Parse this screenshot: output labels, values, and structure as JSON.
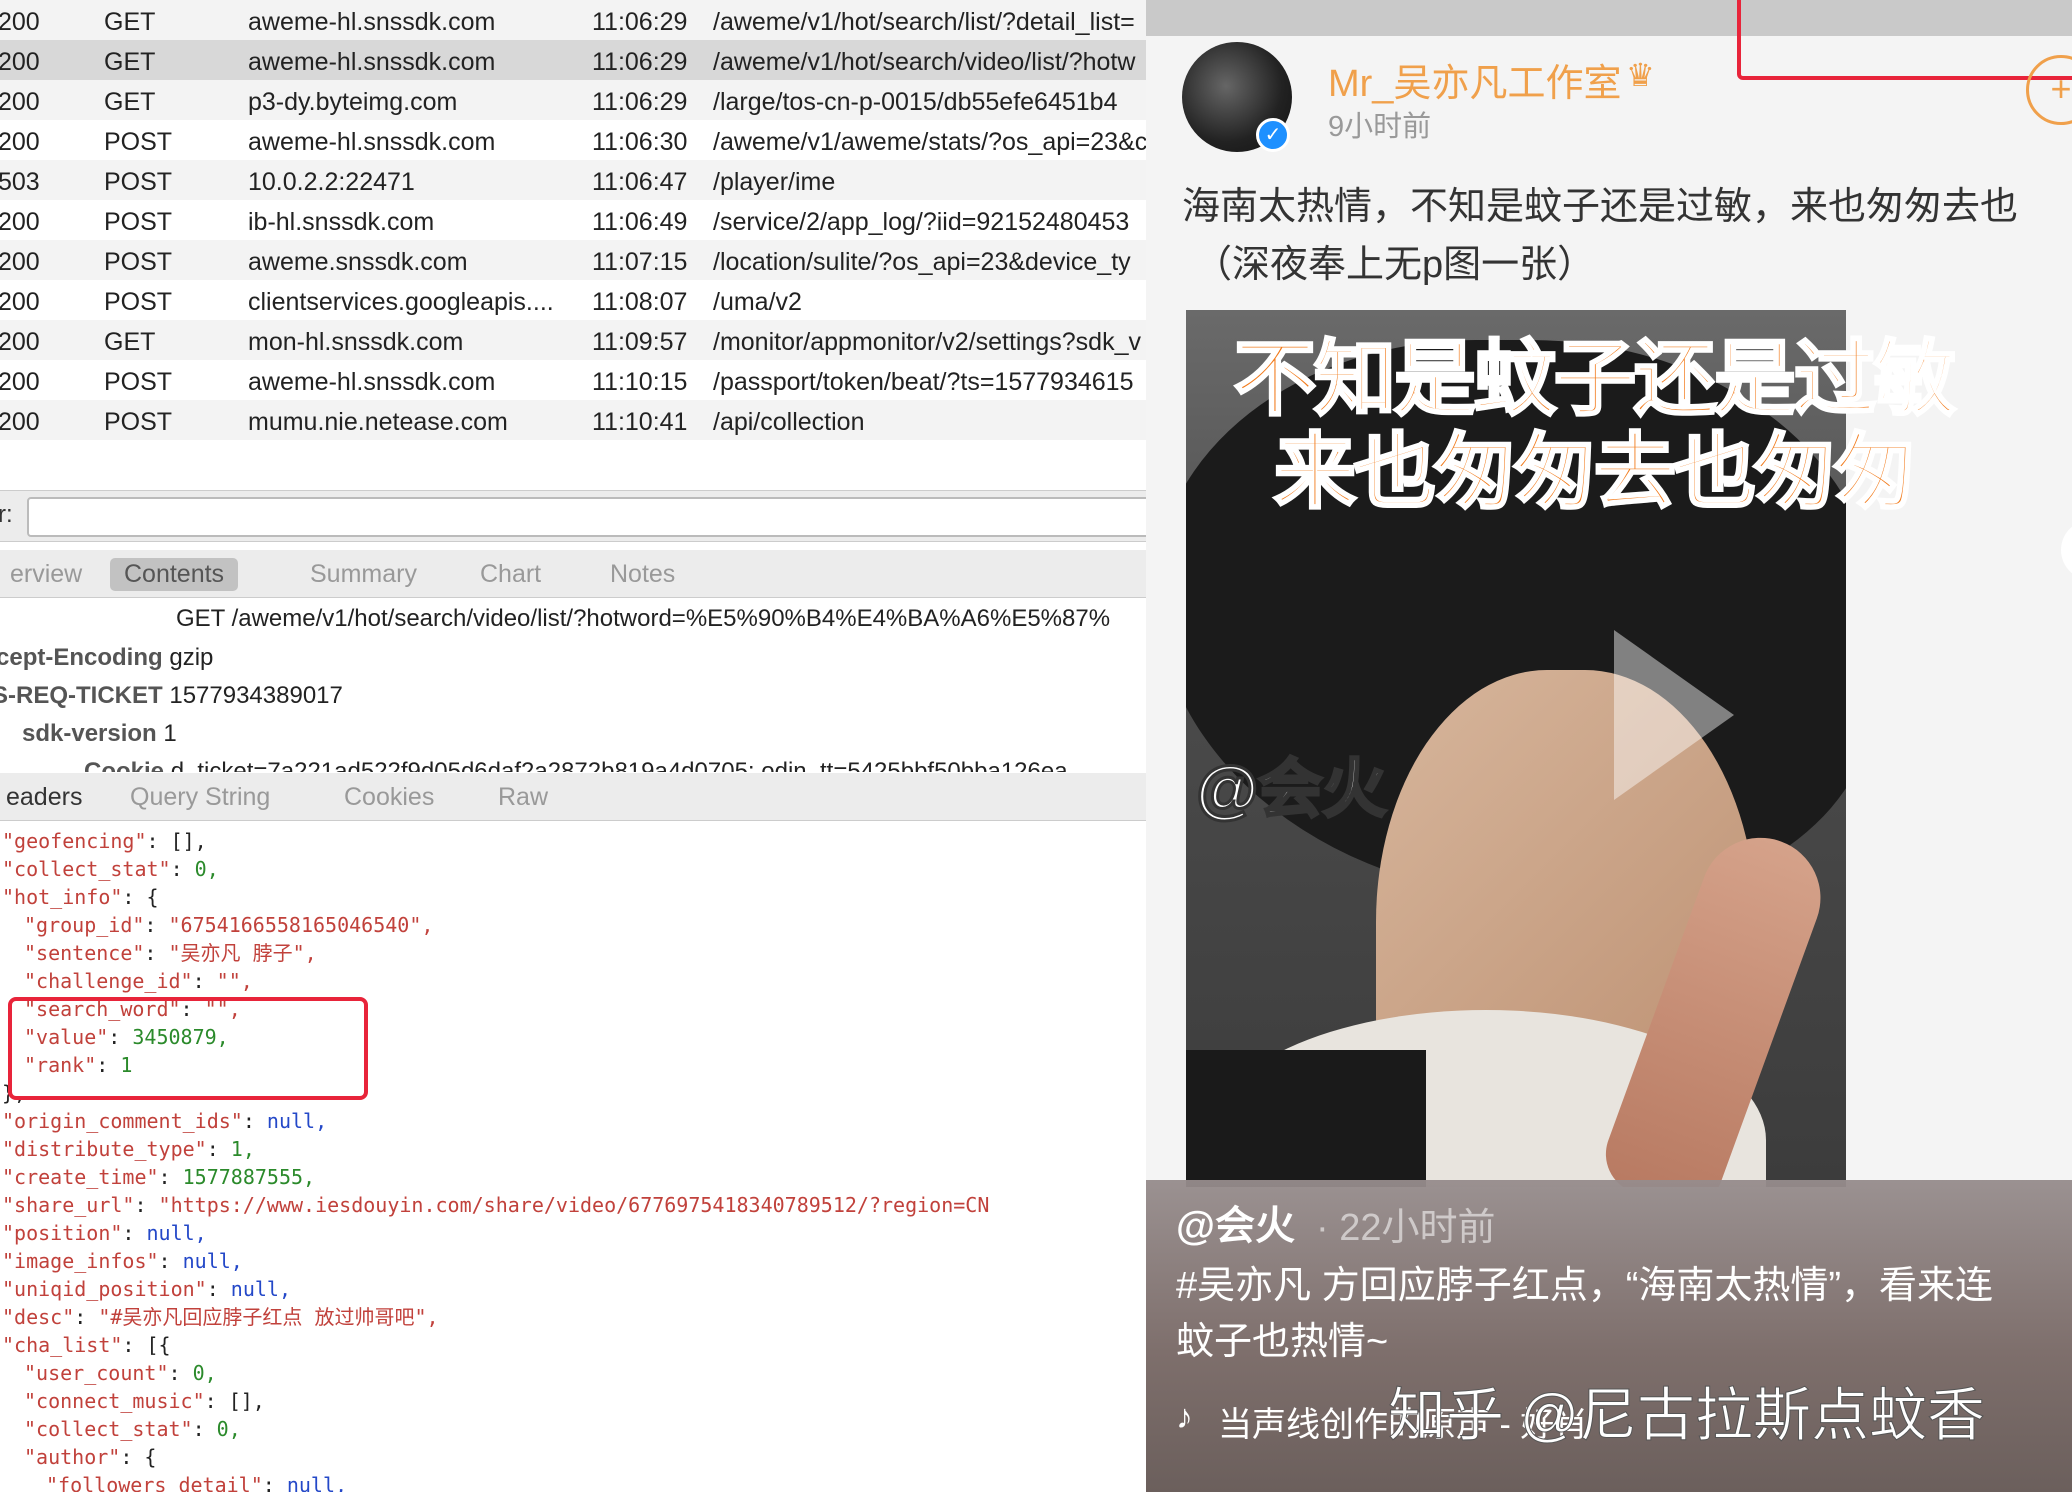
{
  "requests": [
    {
      "status": "200",
      "method": "GET",
      "host": "aweme-hl.snssdk.com",
      "time": "11:06:29",
      "path": "/aweme/v1/hot/search/list/?detail_list="
    },
    {
      "status": "200",
      "method": "GET",
      "host": "aweme-hl.snssdk.com",
      "time": "11:06:29",
      "path": "/aweme/v1/hot/search/video/list/?hotw"
    },
    {
      "status": "200",
      "method": "GET",
      "host": "p3-dy.byteimg.com",
      "time": "11:06:29",
      "path": "/large/tos-cn-p-0015/db55efe6451b4"
    },
    {
      "status": "200",
      "method": "POST",
      "host": "aweme-hl.snssdk.com",
      "time": "11:06:30",
      "path": "/aweme/v1/aweme/stats/?os_api=23&c"
    },
    {
      "status": "503",
      "method": "POST",
      "host": "10.0.2.2:22471",
      "time": "11:06:47",
      "path": "/player/ime"
    },
    {
      "status": "200",
      "method": "POST",
      "host": "ib-hl.snssdk.com",
      "time": "11:06:49",
      "path": "/service/2/app_log/?iid=92152480453"
    },
    {
      "status": "200",
      "method": "POST",
      "host": "aweme.snssdk.com",
      "time": "11:07:15",
      "path": "/location/sulite/?os_api=23&device_ty"
    },
    {
      "status": "200",
      "method": "POST",
      "host": "clientservices.googleapis....",
      "time": "11:08:07",
      "path": "/uma/v2"
    },
    {
      "status": "200",
      "method": "GET",
      "host": "mon-hl.snssdk.com",
      "time": "11:09:57",
      "path": "/monitor/appmonitor/v2/settings?sdk_v"
    },
    {
      "status": "200",
      "method": "POST",
      "host": "aweme-hl.snssdk.com",
      "time": "11:10:15",
      "path": "/passport/token/beat/?ts=1577934615"
    },
    {
      "status": "200",
      "method": "POST",
      "host": "mumu.nie.netease.com",
      "time": "11:10:41",
      "path": "/api/collection"
    }
  ],
  "filter": {
    "label": "r:",
    "value": ""
  },
  "top_tabs": [
    "erview",
    "Contents",
    "Summary",
    "Chart",
    "Notes"
  ],
  "request_line": "GET /aweme/v1/hot/search/video/list/?hotword=%E5%90%B4%E4%BA%A6%E5%87%",
  "headers": [
    {
      "key": "cept-Encoding",
      "value": "gzip"
    },
    {
      "key": "S-REQ-TICKET",
      "value": "1577934389017"
    },
    {
      "key": "sdk-version",
      "value": "1"
    },
    {
      "key": "Cookie",
      "value": "d_ticket=7a221ad522f9d05d6daf2a2872b819a4d0705; odin_tt=5425bbf50bba126ea"
    }
  ],
  "bottom_tabs": [
    "eaders",
    "Query String",
    "Cookies",
    "Raw"
  ],
  "json_lines": [
    {
      "k": "\"geofencing\"",
      "sep": ": ",
      "v": "[],",
      "vt": "p",
      "ind": 0
    },
    {
      "k": "\"collect_stat\"",
      "sep": ": ",
      "v": "0,",
      "vt": "n",
      "ind": 0
    },
    {
      "k": "\"hot_info\"",
      "sep": ": ",
      "v": "{",
      "vt": "p",
      "ind": 0
    },
    {
      "k": "\"group_id\"",
      "sep": ": ",
      "v": "\"6754166558165046540\",",
      "vt": "s",
      "ind": 1
    },
    {
      "k": "\"sentence\"",
      "sep": ": ",
      "v": "\"吴亦凡 脖子\",",
      "vt": "s",
      "ind": 1
    },
    {
      "k": "\"challenge_id\"",
      "sep": ": ",
      "v": "\"\",",
      "vt": "s",
      "ind": 1
    },
    {
      "k": "\"search_word\"",
      "sep": ": ",
      "v": "\"\",",
      "vt": "s",
      "ind": 1
    },
    {
      "k": "\"value\"",
      "sep": ": ",
      "v": "3450879,",
      "vt": "n",
      "ind": 1
    },
    {
      "k": "\"rank\"",
      "sep": ": ",
      "v": "1",
      "vt": "n",
      "ind": 1
    },
    {
      "k": "",
      "sep": "",
      "v": "},",
      "vt": "p",
      "ind": 0
    },
    {
      "k": "\"origin_comment_ids\"",
      "sep": ": ",
      "v": "null,",
      "vt": "l",
      "ind": 0
    },
    {
      "k": "\"distribute_type\"",
      "sep": ": ",
      "v": "1,",
      "vt": "n",
      "ind": 0
    },
    {
      "k": "\"create_time\"",
      "sep": ": ",
      "v": "1577887555,",
      "vt": "n",
      "ind": 0
    },
    {
      "k": "\"share_url\"",
      "sep": ": ",
      "v": "\"https://www.iesdouyin.com/share/video/6776975418340789512/?region=CN",
      "vt": "s",
      "ind": 0
    },
    {
      "k": "\"position\"",
      "sep": ": ",
      "v": "null,",
      "vt": "l",
      "ind": 0
    },
    {
      "k": "\"image_infos\"",
      "sep": ": ",
      "v": "null,",
      "vt": "l",
      "ind": 0
    },
    {
      "k": "\"uniqid_position\"",
      "sep": ": ",
      "v": "null,",
      "vt": "l",
      "ind": 0
    },
    {
      "k": "\"desc\"",
      "sep": ": ",
      "v": "\"#吴亦凡回应脖子红点 放过帅哥吧\",",
      "vt": "s",
      "ind": 0
    },
    {
      "k": "\"cha_list\"",
      "sep": ": ",
      "v": "[{",
      "vt": "p",
      "ind": 0
    },
    {
      "k": "\"user_count\"",
      "sep": ": ",
      "v": "0,",
      "vt": "n",
      "ind": 1
    },
    {
      "k": "\"connect_music\"",
      "sep": ": ",
      "v": "[],",
      "vt": "p",
      "ind": 1
    },
    {
      "k": "\"collect_stat\"",
      "sep": ": ",
      "v": "0,",
      "vt": "n",
      "ind": 1
    },
    {
      "k": "\"author\"",
      "sep": ": ",
      "v": "{",
      "vt": "p",
      "ind": 1
    },
    {
      "k": "\"followers_detail\"",
      "sep": ": ",
      "v": "null,",
      "vt": "l",
      "ind": 2
    }
  ],
  "post": {
    "username": "Mr_吴亦凡工作室",
    "time": "9小时前",
    "text_line1": "海南太热情，不知是蚊子还是过敏，来也匆匆去也",
    "text_line2": "（深夜奉上无p图一张）",
    "follow_symbol": "+",
    "verified_symbol": "✓",
    "crown_symbol": "♛",
    "overlay_line1": "不知是蚊子还是过敏",
    "overlay_line2": "来也匆匆去也匆匆",
    "image_watermark": "@会火"
  },
  "caption": {
    "user": "@会火",
    "time": "· 22小时前",
    "text": "#吴亦凡 方回应脖子红点，“海南太热情”，看来连蚊子也热情~",
    "music": "当声线创作的原声 - 好肖",
    "music_icon": "♪"
  },
  "watermark": "知乎 @尼古拉斯点蚊香",
  "colors": {
    "accent_orange": "#f27a1a",
    "highlight_red": "#e8243a",
    "json_key": "#c1413b",
    "json_number": "#2b8a2b",
    "json_null": "#2448c8"
  }
}
